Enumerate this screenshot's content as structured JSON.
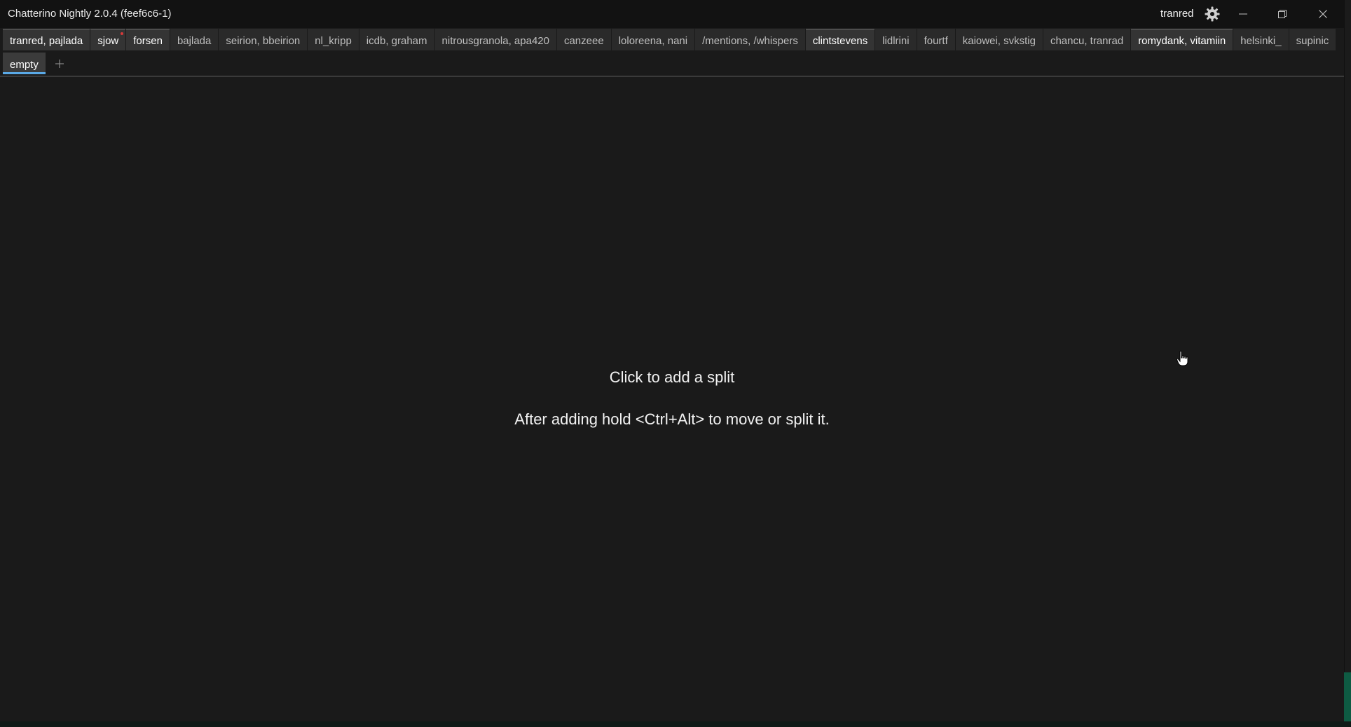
{
  "window": {
    "title": "Chatterino Nightly 2.0.4 (feef6c6-1)",
    "username": "tranred"
  },
  "tabs": {
    "row1": [
      {
        "label": "tranred, pajlada",
        "live": true
      },
      {
        "label": "sjow",
        "live": true,
        "unread": true
      },
      {
        "label": "forsen",
        "live": true
      },
      {
        "label": "bajlada",
        "live": false
      },
      {
        "label": "seirion, bbeirion",
        "live": false
      },
      {
        "label": "nl_kripp",
        "live": false
      },
      {
        "label": "icdb, graham",
        "live": false
      },
      {
        "label": "nitrousgranola, apa420",
        "live": false
      },
      {
        "label": "canzeee",
        "live": false
      },
      {
        "label": "loloreena, nani",
        "live": false
      },
      {
        "label": "/mentions, /whispers",
        "live": false
      },
      {
        "label": "clintstevens",
        "live": true
      },
      {
        "label": "lidlrini",
        "live": false
      },
      {
        "label": "fourtf",
        "live": false
      },
      {
        "label": "kaiowei, svkstig",
        "live": false
      },
      {
        "label": "chancu, tranrad",
        "live": false
      },
      {
        "label": "romydank, vitamiin",
        "live": true
      },
      {
        "label": "helsinki_",
        "live": false
      },
      {
        "label": "supinic",
        "live": false
      }
    ],
    "row2": [
      {
        "label": "empty",
        "selected": true
      }
    ]
  },
  "content": {
    "hint_title": "Click to add a split",
    "hint_sub": "After adding hold <Ctrl+Alt> to move or split it."
  },
  "colors": {
    "accent": "#5aa9e6",
    "unread": "#d63a3a",
    "background": "#1a1a1a",
    "titlebar": "#121212"
  },
  "icons": {
    "settings": "gear-icon",
    "minimize": "minimize-icon",
    "maximize": "restore-icon",
    "close": "close-icon",
    "add_tab": "plus-icon",
    "cursor": "hand-cursor-icon"
  }
}
